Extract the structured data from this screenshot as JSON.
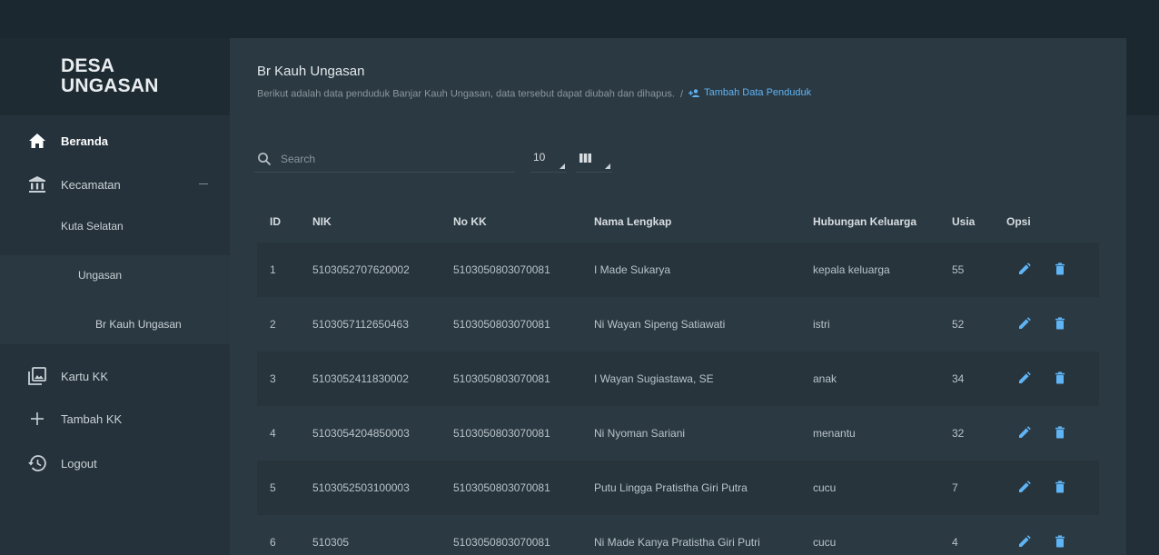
{
  "brand": {
    "line1": "DESA",
    "line2": "UNGASAN"
  },
  "sidebar": {
    "items": [
      {
        "label": "Beranda",
        "icon": "home-icon"
      },
      {
        "label": "Kecamatan",
        "icon": "institution-icon"
      },
      {
        "label": "Kartu KK",
        "icon": "photo-library-icon"
      },
      {
        "label": "Tambah KK",
        "icon": "plus-icon"
      },
      {
        "label": "Logout",
        "icon": "history-icon"
      }
    ],
    "sub": {
      "kecamatan": "Kuta Selatan",
      "desa": "Ungasan",
      "banjar": "Br Kauh Ungasan"
    }
  },
  "header": {
    "title": "Br Kauh Ungasan",
    "subtitle": "Berikut adalah data penduduk Banjar Kauh Ungasan, data tersebut dapat diubah dan dihapus.",
    "separator": "/",
    "add_link": "Tambah Data Penduduk"
  },
  "toolbar": {
    "search_placeholder": "Search",
    "page_size": "10"
  },
  "table": {
    "columns": [
      "ID",
      "NIK",
      "No KK",
      "Nama Lengkap",
      "Hubungan Keluarga",
      "Usia",
      "Opsi"
    ],
    "rows": [
      {
        "id": "1",
        "nik": "5103052707620002",
        "kk": "5103050803070081",
        "nama": "I Made Sukarya",
        "hub": "kepala keluarga",
        "usia": "55"
      },
      {
        "id": "2",
        "nik": "5103057112650463",
        "kk": "5103050803070081",
        "nama": "Ni Wayan Sipeng Satiawati",
        "hub": "istri",
        "usia": "52"
      },
      {
        "id": "3",
        "nik": "5103052411830002",
        "kk": "5103050803070081",
        "nama": "I Wayan Sugiastawa, SE",
        "hub": "anak",
        "usia": "34"
      },
      {
        "id": "4",
        "nik": "5103054204850003",
        "kk": "5103050803070081",
        "nama": "Ni Nyoman Sariani",
        "hub": "menantu",
        "usia": "32"
      },
      {
        "id": "5",
        "nik": "5103052503100003",
        "kk": "5103050803070081",
        "nama": "Putu Lingga Pratistha Giri Putra",
        "hub": "cucu",
        "usia": "7"
      },
      {
        "id": "6",
        "nik": "510305",
        "kk": "5103050803070081",
        "nama": "Ni Made Kanya Pratistha Giri Putri",
        "hub": "cucu",
        "usia": "4"
      }
    ]
  },
  "colors": {
    "accent": "#5fb4f5",
    "sidebar_bg": "#25323b",
    "content_bg": "#2b3942",
    "row_alt": "#27343c"
  }
}
